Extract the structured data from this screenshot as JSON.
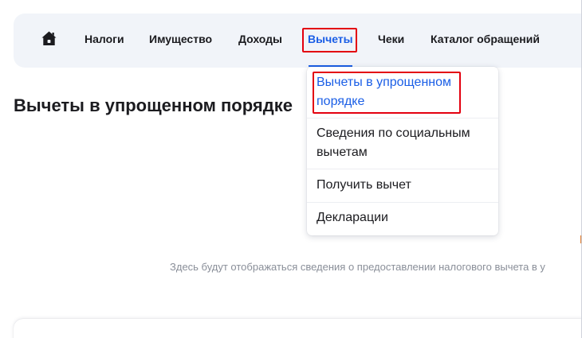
{
  "nav": {
    "home_label": "home",
    "items": [
      {
        "label": "Налоги"
      },
      {
        "label": "Имущество"
      },
      {
        "label": "Доходы"
      },
      {
        "label": "Вычеты"
      },
      {
        "label": "Чеки"
      },
      {
        "label": "Каталог обращений"
      }
    ],
    "active_index": 3
  },
  "page": {
    "title": "Вычеты в упрощенном порядке",
    "empty_message": "Здесь будут отображаться сведения о предоставлении налогового вычета в у"
  },
  "dropdown": {
    "items": [
      {
        "label_line1": "Вычеты в упрощенном",
        "label_line2": "порядке"
      },
      {
        "label_line1": "Сведения по социальным",
        "label_line2": "вычетам"
      },
      {
        "label_line1": "Получить вычет"
      },
      {
        "label_line1": "Декларации"
      }
    ],
    "selected_index": 0
  },
  "colors": {
    "accent": "#1a5ee6",
    "highlight": "#e3000f",
    "nav_bg": "#f1f4f9",
    "muted_text": "#8a8f99"
  },
  "icons": {
    "home": "home-icon"
  }
}
